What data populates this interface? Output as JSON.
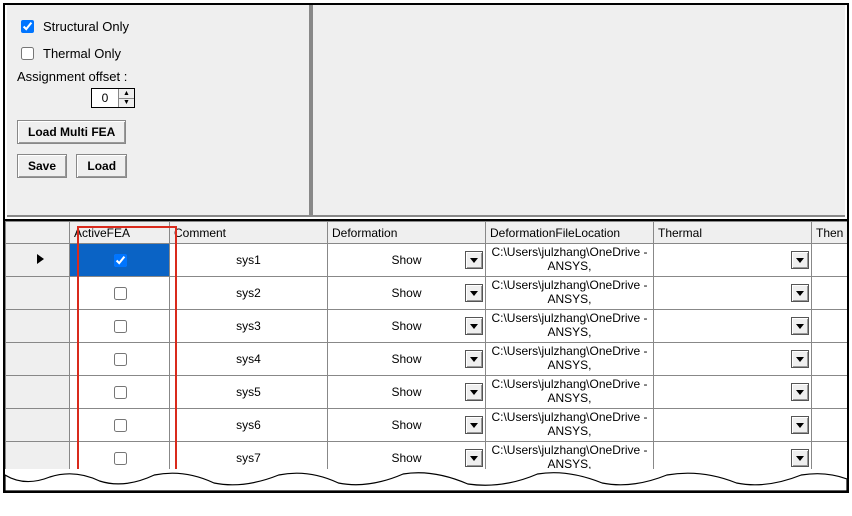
{
  "options": {
    "structural_label": "Structural Only",
    "structural_checked": true,
    "thermal_label": "Thermal Only",
    "thermal_checked": false,
    "assignment_offset_label": "Assignment offset :",
    "assignment_offset_value": "0"
  },
  "buttons": {
    "load_multi": "Load Multi FEA",
    "save": "Save",
    "load": "Load"
  },
  "grid": {
    "headers": {
      "active": "ActiveFEA",
      "comment": "Comment",
      "deformation": "Deformation",
      "deformation_loc": "DeformationFileLocation",
      "thermal": "Thermal",
      "thermal_loc": "Then"
    },
    "deformation_value": "Show",
    "location_value": "C:\\Users\\julzhang\\OneDrive - ANSYS,",
    "rows": [
      {
        "active": true,
        "selected": true,
        "comment": "sys1"
      },
      {
        "active": false,
        "selected": false,
        "comment": "sys2"
      },
      {
        "active": false,
        "selected": false,
        "comment": "sys3"
      },
      {
        "active": false,
        "selected": false,
        "comment": "sys4"
      },
      {
        "active": false,
        "selected": false,
        "comment": "sys5"
      },
      {
        "active": false,
        "selected": false,
        "comment": "sys6"
      },
      {
        "active": false,
        "selected": false,
        "comment": "sys7"
      }
    ]
  }
}
